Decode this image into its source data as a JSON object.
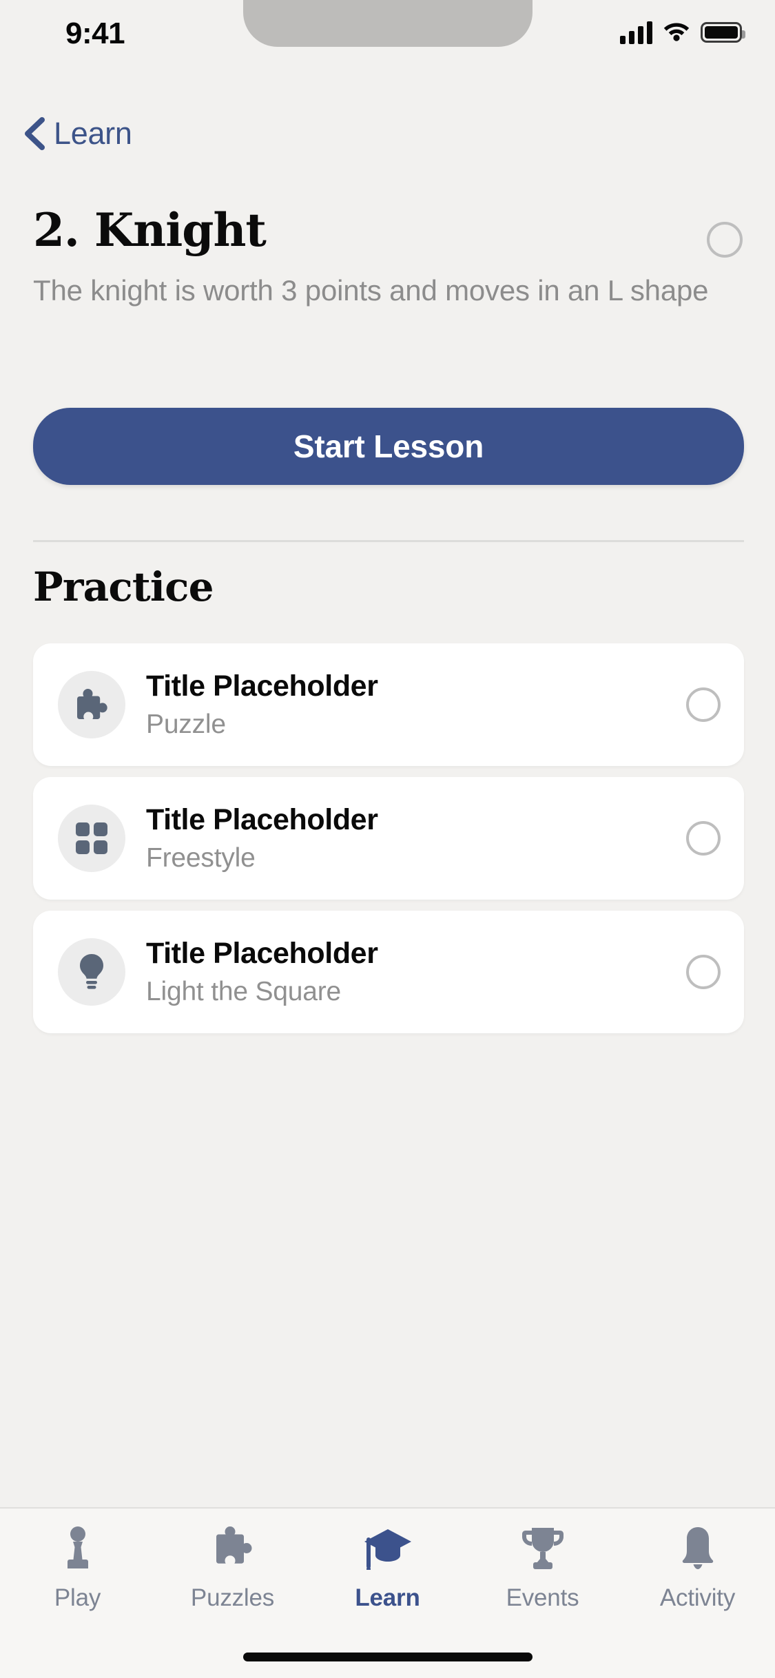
{
  "status_bar": {
    "time": "9:41",
    "icons": [
      "cellular-signal-icon",
      "wifi-icon",
      "battery-icon"
    ]
  },
  "nav": {
    "back_label": "Learn",
    "back_icon": "chevron-left-icon",
    "accent_color": "#3D5489"
  },
  "lesson": {
    "title": "2. Knight",
    "description": "The knight is worth 3 points and moves in an L shape",
    "completed": false,
    "start_button_label": "Start Lesson",
    "start_button_color": "#3C528C"
  },
  "practice": {
    "heading": "Practice",
    "items": [
      {
        "title": "Title Placeholder",
        "subtitle": "Puzzle",
        "icon": "puzzle-piece-icon",
        "completed": false
      },
      {
        "title": "Title Placeholder",
        "subtitle": "Freestyle",
        "icon": "grid-squares-icon",
        "completed": false
      },
      {
        "title": "Title Placeholder",
        "subtitle": "Light the Square",
        "icon": "lightbulb-icon",
        "completed": false
      }
    ]
  },
  "tab_bar": {
    "active": "Learn",
    "items": [
      {
        "label": "Play",
        "icon": "chess-pawn-icon"
      },
      {
        "label": "Puzzles",
        "icon": "puzzle-piece-icon"
      },
      {
        "label": "Learn",
        "icon": "graduation-cap-icon"
      },
      {
        "label": "Events",
        "icon": "trophy-icon"
      },
      {
        "label": "Activity",
        "icon": "bell-icon"
      }
    ],
    "inactive_color": "#7D8493",
    "active_color": "#3C528C"
  }
}
